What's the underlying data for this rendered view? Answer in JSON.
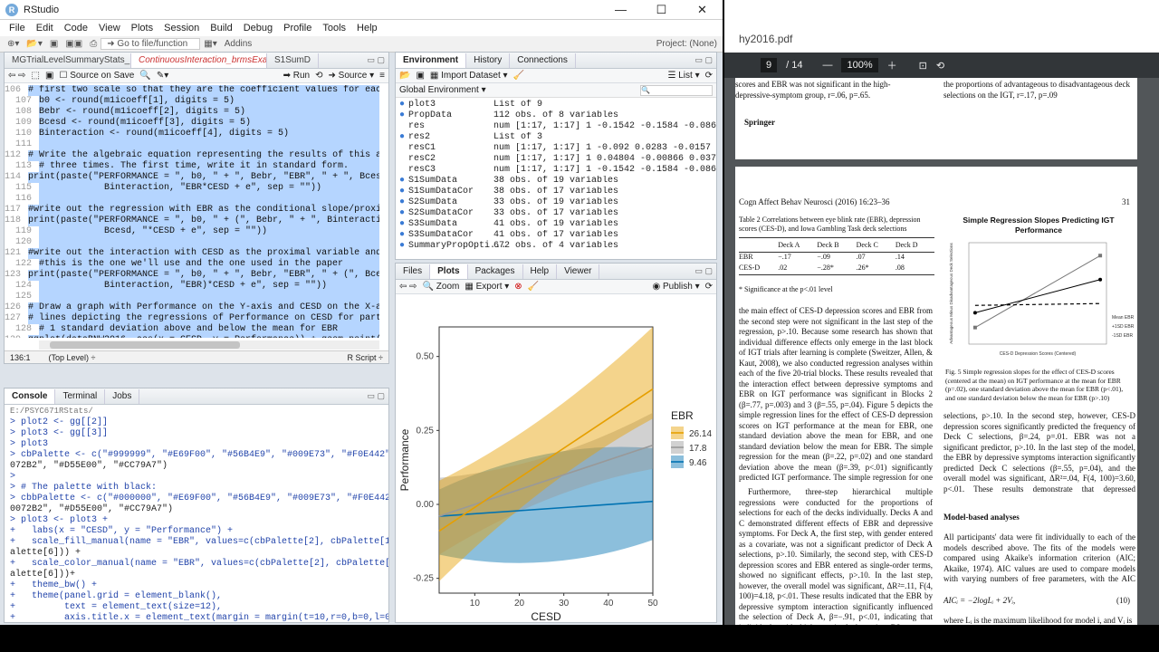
{
  "window": {
    "title": "RStudio",
    "min": "—",
    "max": "☐",
    "close": "✕"
  },
  "menu": [
    "File",
    "Edit",
    "Code",
    "View",
    "Plots",
    "Session",
    "Build",
    "Debug",
    "Profile",
    "Tools",
    "Help"
  ],
  "toolbar": {
    "goto": "Go to file/function",
    "addins": "Addins",
    "project": "Project: (None)"
  },
  "editor": {
    "tabs": [
      "MGTrialLevelSummaryStats_Exp1.R",
      "ContinuousInteraction_brmsExampleOn...*",
      "S1SumD"
    ],
    "source_on_save": "Source on Save",
    "run": "Run",
    "source": "Source",
    "lines": [
      {
        "n": "106",
        "t": "# first two scale so that they are the coefficient values for each"
      },
      {
        "n": "107",
        "t": "b0 <- round(m1icoeff[1], digits = 5)"
      },
      {
        "n": "108",
        "t": "Bebr <- round(m1icoeff[2], digits = 5)"
      },
      {
        "n": "109",
        "t": "Bcesd <- round(m1icoeff[3], digits = 5)"
      },
      {
        "n": "110",
        "t": "Binteraction <- round(m1icoeff[4], digits = 5)"
      },
      {
        "n": "111",
        "t": ""
      },
      {
        "n": "112",
        "t": "# Write the algebraic equation representing the results of this analy"
      },
      {
        "n": "113",
        "t": "# three times. The first time, write it in standard form."
      },
      {
        "n": "114",
        "t": "print(paste(\"PERFORMANCE = \", b0, \" + \", Bebr, \"EBR\", \" + \", Bcesd,"
      },
      {
        "n": "115",
        "t": "            Binteraction, \"EBR*CESD + e\", sep = \"\"))"
      },
      {
        "n": "116",
        "t": ""
      },
      {
        "n": "117",
        "t": "#write out the regression with EBR as the conditional slope/proximal"
      },
      {
        "n": "118",
        "t": "print(paste(\"PERFORMANCE = \", b0, \" + (\", Bebr, \" + \", Binteraction,"
      },
      {
        "n": "119",
        "t": "            Bcesd, \"*CESD + e\", sep = \"\"))"
      },
      {
        "n": "120",
        "t": ""
      },
      {
        "n": "121",
        "t": "#write out the interaction with CESD as the proximal variable and EBR"
      },
      {
        "n": "122",
        "t": "#this is the one we'll use and the one used in the paper"
      },
      {
        "n": "123",
        "t": "print(paste(\"PERFORMANCE = \", b0, \" + \", Bebr, \"EBR\", \" + (\", Bcesd,"
      },
      {
        "n": "124",
        "t": "            Binteraction, \"EBR)*CESD + e\", sep = \"\"))"
      },
      {
        "n": "125",
        "t": ""
      },
      {
        "n": "126",
        "t": "# Draw a graph with Performance on the Y-axis and CESD on the X-axis."
      },
      {
        "n": "127",
        "t": "# lines depicting the regressions of Performance on CESD for particip"
      },
      {
        "n": "128",
        "t": "# 1 standard deviation above and below the mean for EBR"
      },
      {
        "n": "129",
        "t": "ggplot(dataBNW2016, aes(x = CESD, y = Performance)) + geom_point(shap"
      },
      {
        "n": "130",
        "t": "  geom_abline(aes(intercept = b0 + meanEBR * Bebr, slope = Bcesd + mea"
      },
      {
        "n": "131",
        "t": "              show.legend = TRUE) +"
      },
      {
        "n": "132",
        "t": "  geom_abline(aes(intercept = b0 + meanEBRMinusSD * Bebr, slope = Bce"
      },
      {
        "n": "133",
        "t": "              show.legend = TRUE) +"
      },
      {
        "n": "134",
        "t": "  geom_abline(aes(intercept = b0 + meanEBRPlusSD * Bebr, slope = Bces"
      },
      {
        "n": "135",
        "t": "              show.legend = TRUE) +"
      },
      {
        "n": "136",
        "t": "  guides(color = guide_legend(title = \"EBR\"))"
      }
    ],
    "status_pos": "136:1",
    "status_scope": "(Top Level) ÷",
    "status_type": "R Script ÷"
  },
  "console": {
    "tabs": [
      "Console",
      "Terminal",
      "Jobs"
    ],
    "path": "E:/PSYC671RStats/",
    "lines": [
      "> plot2 <- gg[[2]]",
      "> plot3 <- gg[[3]]",
      "> plot3",
      "> cbPalette <- c(\"#999999\", \"#E69F00\", \"#56B4E9\", \"#009E73\", \"#F0E442\", \"#0",
      "072B2\", \"#D55E00\", \"#CC79A7\")",
      ">",
      "> # The palette with black:",
      "> cbbPalette <- c(\"#000000\", \"#E69F00\", \"#56B4E9\", \"#009E73\", \"#F0E442\", \"#",
      "0072B2\", \"#D55E00\", \"#CC79A7\")",
      "> plot3 <- plot3 +",
      "+   labs(x = \"CESD\", y = \"Performance\") +",
      "+   scale_fill_manual(name = \"EBR\", values=c(cbPalette[2], cbPalette[1],cbP",
      "alette[6])) +",
      "+   scale_color_manual(name = \"EBR\", values=c(cbPalette[2], cbPalette[1],cbP",
      "alette[6]))+",
      "+   theme_bw() +",
      "+   theme(panel.grid = element_blank(),",
      "+         text = element_text(size=12),",
      "+         axis.title.x = element_text(margin = margin(t=10,r=0,b=0,l=0)),",
      "+         axis.title.y = element_text(margin = margin(t=0,r=10,b=0,l=0)))",
      "> plot3",
      ">"
    ]
  },
  "environment": {
    "tabs": [
      "Environment",
      "History",
      "Connections"
    ],
    "import": "Import Dataset",
    "list": "List",
    "scope": "Global Environment",
    "rows": [
      {
        "k": "plot3",
        "v": "List of 9",
        "icon": "list"
      },
      {
        "k": "PropData",
        "v": "112 obs. of 8 variables",
        "icon": "data"
      },
      {
        "k": "res",
        "v": "num [1:17, 1:17] 1 -0.1542 -0.1584 -0.086...",
        "icon": "none"
      },
      {
        "k": "res2",
        "v": "List of 3",
        "icon": "list"
      },
      {
        "k": "resC1",
        "v": "num [1:17, 1:17] 1 -0.092 0.0283 -0.0157 ...",
        "icon": "none"
      },
      {
        "k": "resC2",
        "v": "num [1:17, 1:17] 1 0.04804 -0.00866 0.037...",
        "icon": "none"
      },
      {
        "k": "resC3",
        "v": "num [1:17, 1:17] 1 -0.1542 -0.1584 -0.086...",
        "icon": "none"
      },
      {
        "k": "S1SumData",
        "v": "38 obs. of 19 variables",
        "icon": "data"
      },
      {
        "k": "S1SumDataCor",
        "v": "38 obs. of 17 variables",
        "icon": "data"
      },
      {
        "k": "S2SumData",
        "v": "33 obs. of 19 variables",
        "icon": "data"
      },
      {
        "k": "S2SumDataCor",
        "v": "33 obs. of 17 variables",
        "icon": "data"
      },
      {
        "k": "S3SumData",
        "v": "41 obs. of 19 variables",
        "icon": "data"
      },
      {
        "k": "S3SumDataCor",
        "v": "41 obs. of 17 variables",
        "icon": "data"
      },
      {
        "k": "SummaryPropOpti...",
        "v": "672 obs. of 4 variables",
        "icon": "data"
      }
    ]
  },
  "plots": {
    "tabs": [
      "Files",
      "Plots",
      "Packages",
      "Help",
      "Viewer"
    ],
    "zoom": "Zoom",
    "export": "Export",
    "publish": "Publish"
  },
  "chart_data": {
    "type": "line",
    "xlabel": "CESD",
    "ylabel": "Performance",
    "xlim": [
      2,
      50
    ],
    "ylim": [
      -0.3,
      0.6
    ],
    "xticks": [
      10,
      20,
      30,
      40,
      50
    ],
    "yticks": [
      -0.25,
      0.0,
      0.25,
      0.5
    ],
    "ytick_labels": [
      "-0.25",
      "0.00",
      "0.25",
      "0.50"
    ],
    "legend_title": "EBR",
    "legend_position": "right",
    "series": [
      {
        "name": "26.14",
        "color": "#E69F00",
        "x": [
          2,
          50
        ],
        "y": [
          -0.09,
          0.39
        ],
        "lower": [
          -0.26,
          0.29
        ],
        "upper": [
          0.08,
          0.6
        ]
      },
      {
        "name": "17.8",
        "color": "#999999",
        "x": [
          2,
          50
        ],
        "y": [
          -0.04,
          0.2
        ],
        "lower": [
          -0.17,
          0.12
        ],
        "upper": [
          0.09,
          0.31
        ]
      },
      {
        "name": "9.46",
        "color": "#0072B2",
        "x": [
          2,
          50
        ],
        "y": [
          -0.04,
          0.01
        ],
        "lower": [
          -0.17,
          -0.12
        ],
        "upper": [
          0.05,
          0.19
        ]
      }
    ]
  },
  "pdf": {
    "filename": "hy2016.pdf",
    "page": "9",
    "total": "/ 14",
    "zoom": "100%",
    "top_left": "scores and EBR was not significant in the high-depressive-symptom group, r=.06, p=.65.",
    "top_right": "the proportions of advantageous to disadvantageous deck selections on the IGT, r=.17, p=.09",
    "springer": "Springer",
    "header_left": "Cogn Affect Behav Neurosci (2016) 16:23–36",
    "header_right": "31",
    "table_caption": "Table 2   Correlations between eye blink rate (EBR), depression scores (CES-D), and Iowa Gambling Task deck selections",
    "table_head": [
      "",
      "Deck A",
      "Deck B",
      "Deck C",
      "Deck D"
    ],
    "table_rows": [
      [
        "EBR",
        "−.17",
        "−.09",
        ".07",
        ".14"
      ],
      [
        "CES-D",
        ".02",
        "−.28*",
        ".26*",
        ".08"
      ]
    ],
    "table_note": "* Significance at the p<.01 level",
    "fig_title": "Simple Regression Slopes Predicting IGT Performance",
    "fig_caption": "Fig. 5  Simple regression slopes for the effect of CES-D scores (centered at the mean) on IGT performance at the mean for EBR (p=.02), one standard deviation above the mean for EBR (p<.01), and one standard deviation below the mean for EBR (p>.10)",
    "body_left": "the main effect of CES-D depression scores and EBR from the second step were not significant in the last step of the regression, p>.10. Because some research has shown that individual difference effects only emerge in the last block of IGT trials after learning is complete (Sweitzer, Allen, & Kaut, 2008), we also conducted regression analyses within each of the five 20-trial blocks. These results revealed that the interaction effect between depressive symptoms and EBR on IGT performance was significant in Blocks 2 (β=.77, p=.003) and 3 (β=.55, p=.04). Figure 5 depicts the simple regression lines for the effect of CES-D depression scores on IGT performance at the mean for EBR, one standard deviation above the mean for EBR, and one standard deviation below the mean for EBR. The simple regression for the mean (β=.22, p=.02) and one standard deviation above the mean (β=.39, p<.01) significantly predicted IGT performance. The simple regression for one standard deviation below the mean, however, was not significant, p>.10.",
    "body_left2": "Furthermore, three-step hierarchical multiple regressions were conducted for the proportions of selections for each of the decks individually. Decks A and C demonstrated different effects of EBR and depressive symptoms. For Deck A, the first step, with gender entered as a covariate, was not a significant predictor of Deck A selections, p>.10. Similarly, the second step, with CES-D depression scores and EBR entered as single-order terms, showed no significant effects, p>.10. In the last step, however, the overall model was significant, ΔR²=.11, F(4, 100)=4.18, p<.01. These results indicated that the EBR by depressive symptom interaction significantly influenced the selection of Deck A, β=−.91, p<.01, indicating that individuals with higher striatal dopamine D2 receptor density and higher depression scores tended to",
    "body_right": "selections, p>.10. In the second step, however, CES-D depression scores significantly predicted the frequency of Deck C selections, β=.24, p=.01. EBR was not a significant predictor, p>.10. In the last step of the model, the EBR by depressive symptoms interaction significantly predicted Deck C selections (β=.55, p=.04), and the overall model was significant, ΔR²=.04, F(4, 100)=3.60, p<.01. These results demonstrate that depressed individuals with higher blink rates tended to choose Deck C more and Deck A less often.",
    "section": "Model-based analyses",
    "body_right2": "All participants' data were fit individually to each of the models described above. The fits of the models were compared using Akaike's information criterion (AIC; Akaike, 1974). AIC values are used to compare models with varying numbers of free parameters, with the AIC penalizing models with more free parameters. For each model i, AIC is defined as:",
    "equation": "AICᵢ = −2logLᵢ + 2Vᵢ,",
    "eq_num": "(10)",
    "body_right3": "where Lᵢ is the maximum likelihood for model i, and Vᵢ is the",
    "mini_legend": [
      "Mean EBR",
      "+1SD EBR",
      "-1SD EBR"
    ],
    "mini_xlabel": "CES-D Depression Scores (Centered)",
    "mini_ylabel": "Advantageous Minus Disadvantageous Deck Selections"
  }
}
